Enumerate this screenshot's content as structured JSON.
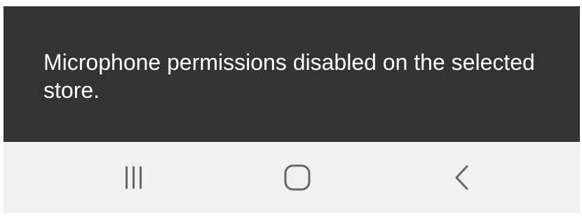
{
  "snackbar": {
    "message": "Microphone permissions disabled on the selected store.",
    "background": "#333333",
    "text_color": "#ffffff"
  },
  "navbar": {
    "background": "#f1f1f1",
    "icon_color": "#666666",
    "buttons": [
      {
        "name": "recents",
        "icon": "recents-icon"
      },
      {
        "name": "home",
        "icon": "home-icon"
      },
      {
        "name": "back",
        "icon": "back-icon"
      }
    ]
  }
}
